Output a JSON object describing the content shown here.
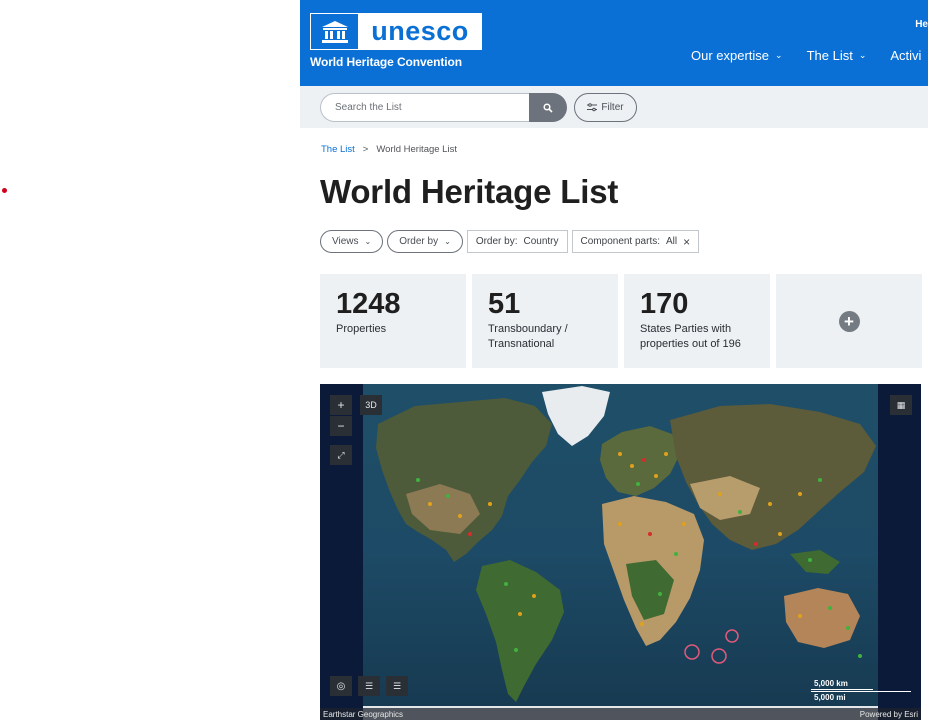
{
  "header": {
    "logo_word": "unesco",
    "subtitle": "World Heritage Convention",
    "top_right": "He",
    "nav": [
      {
        "label": "Our expertise"
      },
      {
        "label": "The List"
      },
      {
        "label": "Activi"
      }
    ]
  },
  "search": {
    "placeholder": "Search the List",
    "filter_label": "Filter"
  },
  "breadcrumb": {
    "root": "The List",
    "separator": ">",
    "current": "World Heritage List"
  },
  "page_title": "World Heritage List",
  "controls": {
    "views_label": "Views",
    "order_by_label": "Order by",
    "order_tag_key": "Order by:",
    "order_tag_value": "Country",
    "component_tag_key": "Component parts:",
    "component_tag_value": "All",
    "remove_symbol": "×"
  },
  "stats": [
    {
      "number": "1248",
      "label": "Properties"
    },
    {
      "number": "51",
      "label": "Transboundary / Transnational"
    },
    {
      "number": "170",
      "label": "States Parties with properties out of 196"
    }
  ],
  "map": {
    "view_3d": "3D",
    "zoom_in": "+",
    "zoom_out": "−",
    "scale_km": "5,000 km",
    "scale_mi": "5,000 mi",
    "attribution_left": "Earthstar Geographics",
    "attribution_right": "Powered by Esri"
  },
  "colors": {
    "brand_blue": "#0a70d5",
    "site_cultural": "#e0a21b",
    "site_natural": "#3fb23f",
    "site_danger": "#d62c2c"
  }
}
